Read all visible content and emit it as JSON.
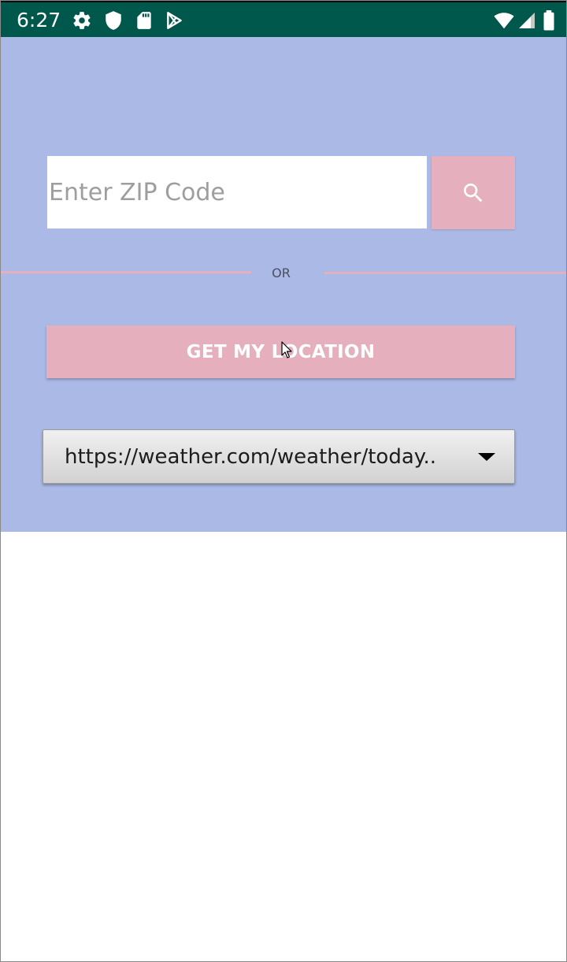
{
  "status_bar": {
    "time": "6:27",
    "color": "#00574b",
    "left_icons": [
      "gear-icon",
      "shield-icon",
      "sd-card-icon",
      "play-store-icon"
    ],
    "right_icons": [
      "wifi-icon",
      "signal-icon",
      "battery-icon"
    ]
  },
  "zip": {
    "placeholder": "Enter ZIP Code",
    "value": ""
  },
  "search": {
    "icon": "search-icon"
  },
  "divider": {
    "label": "OR"
  },
  "location": {
    "button_label": "GET MY LOCATION"
  },
  "source": {
    "selected": "https://weather.com/weather/today.."
  },
  "colors": {
    "background": "#abb9e6",
    "accent": "#e5afbd",
    "status_bar": "#00574b"
  }
}
